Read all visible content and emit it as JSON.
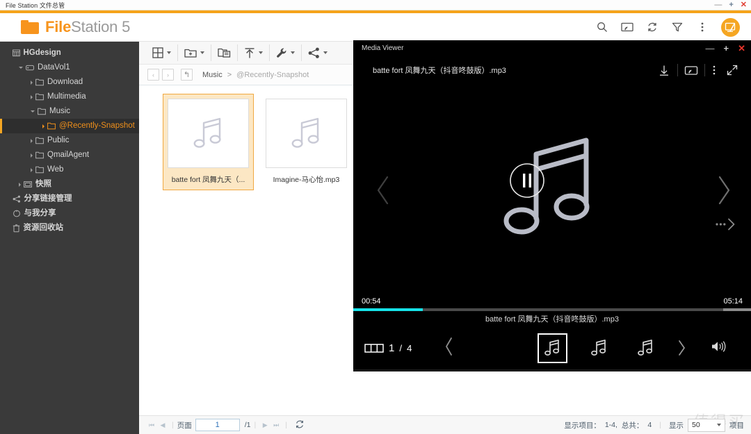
{
  "os_window": {
    "title": "File Station 文件总管",
    "minimize": "—",
    "maximize": "+",
    "close": "✕"
  },
  "header": {
    "brand_bold": "File",
    "brand_rest": "Station 5",
    "icons": [
      "search-icon",
      "cast-icon",
      "refresh-icon",
      "filter-icon",
      "more-vertical-icon",
      "app-badge-icon"
    ]
  },
  "sidebar": {
    "items": [
      {
        "label": "HGdesign",
        "icon": "server-icon",
        "indent": 0,
        "arrow": "none",
        "bold": true,
        "selected": false
      },
      {
        "label": "DataVol1",
        "icon": "volume-icon",
        "indent": 1,
        "arrow": "down",
        "bold": false,
        "selected": false
      },
      {
        "label": "Download",
        "icon": "folder-icon",
        "indent": 2,
        "arrow": "right",
        "bold": false,
        "selected": false
      },
      {
        "label": "Multimedia",
        "icon": "folder-icon",
        "indent": 2,
        "arrow": "right",
        "bold": false,
        "selected": false
      },
      {
        "label": "Music",
        "icon": "folder-icon",
        "indent": 2,
        "arrow": "down",
        "bold": false,
        "selected": false
      },
      {
        "label": "@Recently-Snapshot",
        "icon": "folder-icon",
        "indent": 3,
        "arrow": "right",
        "bold": false,
        "selected": true
      },
      {
        "label": "Public",
        "icon": "folder-icon",
        "indent": 2,
        "arrow": "right",
        "bold": false,
        "selected": false
      },
      {
        "label": "QmailAgent",
        "icon": "folder-icon",
        "indent": 2,
        "arrow": "right",
        "bold": false,
        "selected": false
      },
      {
        "label": "Web",
        "icon": "folder-icon",
        "indent": 2,
        "arrow": "right",
        "bold": false,
        "selected": false
      },
      {
        "label": "快照",
        "icon": "snapshot-icon",
        "indent": 1,
        "arrow": "right",
        "bold": true,
        "selected": false
      },
      {
        "label": "分享链接管理",
        "icon": "share-icon",
        "indent": 0,
        "arrow": "none",
        "bold": true,
        "selected": false
      },
      {
        "label": "与我分享",
        "icon": "shared-icon",
        "indent": 0,
        "arrow": "none",
        "bold": true,
        "selected": false
      },
      {
        "label": "资源回收站",
        "icon": "recyclebin-icon",
        "indent": 0,
        "arrow": "none",
        "bold": true,
        "selected": false
      }
    ]
  },
  "toolbar": {
    "groups": [
      {
        "name": "view-mode",
        "icon": "grid-view-icon",
        "caret": true
      },
      {
        "name": "new-folder",
        "icon": "new-folder-icon",
        "caret": true
      },
      {
        "name": "copy-paste",
        "icon": "copy-paste-icon",
        "caret": false
      },
      {
        "name": "upload",
        "icon": "upload-icon",
        "caret": true
      },
      {
        "name": "tools",
        "icon": "wrench-icon",
        "caret": true
      },
      {
        "name": "share",
        "icon": "share-nodes-icon",
        "caret": true
      }
    ]
  },
  "breadcrumb": {
    "back": "‹",
    "forward": "›",
    "up": "↰",
    "root": "Music",
    "separator": ">",
    "current": "@Recently-Snapshot"
  },
  "files": [
    {
      "name": "batte fort 凤舞九天（...",
      "icon": "music-note-icon",
      "selected": true
    },
    {
      "name": "Imagine-马心怡.mp3",
      "icon": "music-note-icon",
      "selected": false
    }
  ],
  "statusbar": {
    "page_label": "页面",
    "page_value": "1",
    "page_total": "/1",
    "items_label": "显示项目：",
    "items_range": "1-4,",
    "total_label": "总共：",
    "total_value": "4",
    "show_label": "显示",
    "page_size": "50",
    "items_suffix": "项目",
    "watermark": "值得买"
  },
  "media_viewer": {
    "window_title": "Media Viewer",
    "minimize": "—",
    "maximize": "+",
    "close": "✕",
    "filename": "batte fort 凤舞九天（抖音咚鼓版）.mp3",
    "actions": [
      "download-icon",
      "cast-icon",
      "more-vertical-icon",
      "expand-icon"
    ],
    "current_time": "00:54",
    "total_time": "05:14",
    "progress_percent": 17.5,
    "buffer_percent": 7,
    "now_playing": "batte fort 凤舞九天（抖音咚鼓版）.mp3",
    "playlist_position": "1",
    "playlist_total": "4",
    "playlist_separator": "/",
    "playback_state": "paused",
    "accent_color": "#16e3e8",
    "thumbnails": [
      {
        "name": "music-thumb-1",
        "active": true
      },
      {
        "name": "music-thumb-2",
        "active": false
      },
      {
        "name": "music-thumb-3",
        "active": false
      }
    ]
  }
}
